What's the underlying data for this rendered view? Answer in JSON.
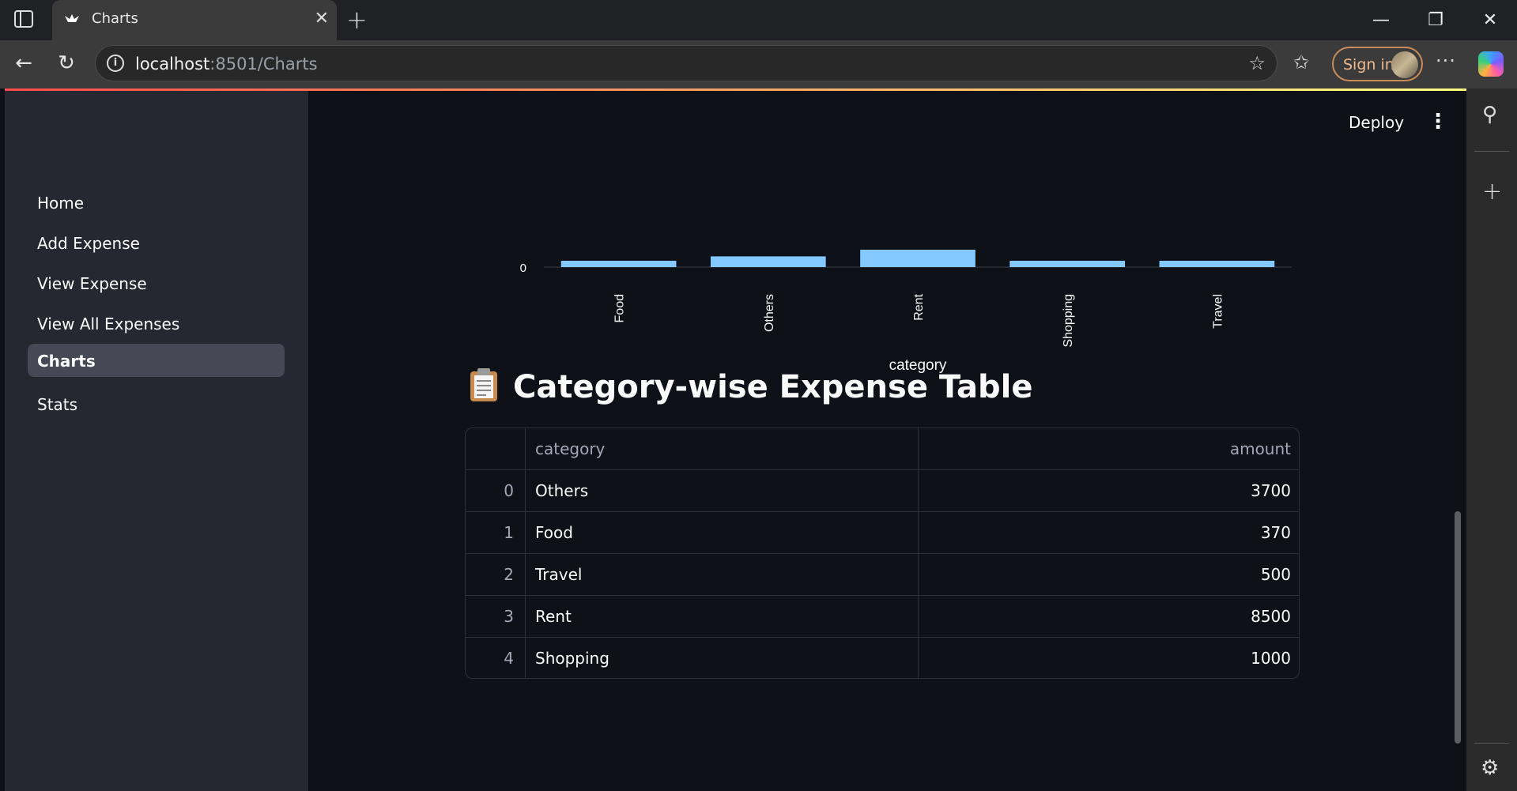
{
  "browser": {
    "tab_title": "Charts",
    "url_host": "localhost",
    "url_path": ":8501/Charts",
    "signin_label": "Sign in"
  },
  "sidebar": {
    "items": [
      {
        "label": "Home"
      },
      {
        "label": "Add Expense"
      },
      {
        "label": "View Expense"
      },
      {
        "label": "View All Expenses"
      },
      {
        "label": "Charts",
        "active": true
      },
      {
        "label": "Stats"
      }
    ]
  },
  "header": {
    "deploy_label": "Deploy"
  },
  "chart_data": {
    "type": "bar",
    "categories": [
      "Food",
      "Others",
      "Rent",
      "Shopping",
      "Travel"
    ],
    "values": [
      370,
      3700,
      8500,
      1000,
      500
    ],
    "xlabel": "category",
    "ytick_visible": "0",
    "bar_color": "#83c9ff"
  },
  "section": {
    "emoji": "clipboard-icon",
    "title": "Category-wise Expense Table"
  },
  "table": {
    "columns": [
      "",
      "category",
      "amount"
    ],
    "rows": [
      {
        "index": "0",
        "category": "Others",
        "amount": "3700"
      },
      {
        "index": "1",
        "category": "Food",
        "amount": "370"
      },
      {
        "index": "2",
        "category": "Travel",
        "amount": "500"
      },
      {
        "index": "3",
        "category": "Rent",
        "amount": "8500"
      },
      {
        "index": "4",
        "category": "Shopping",
        "amount": "1000"
      }
    ]
  },
  "colors": {
    "accent": "#ff4b4b",
    "background": "#0e1117",
    "sidebar": "#262730"
  }
}
